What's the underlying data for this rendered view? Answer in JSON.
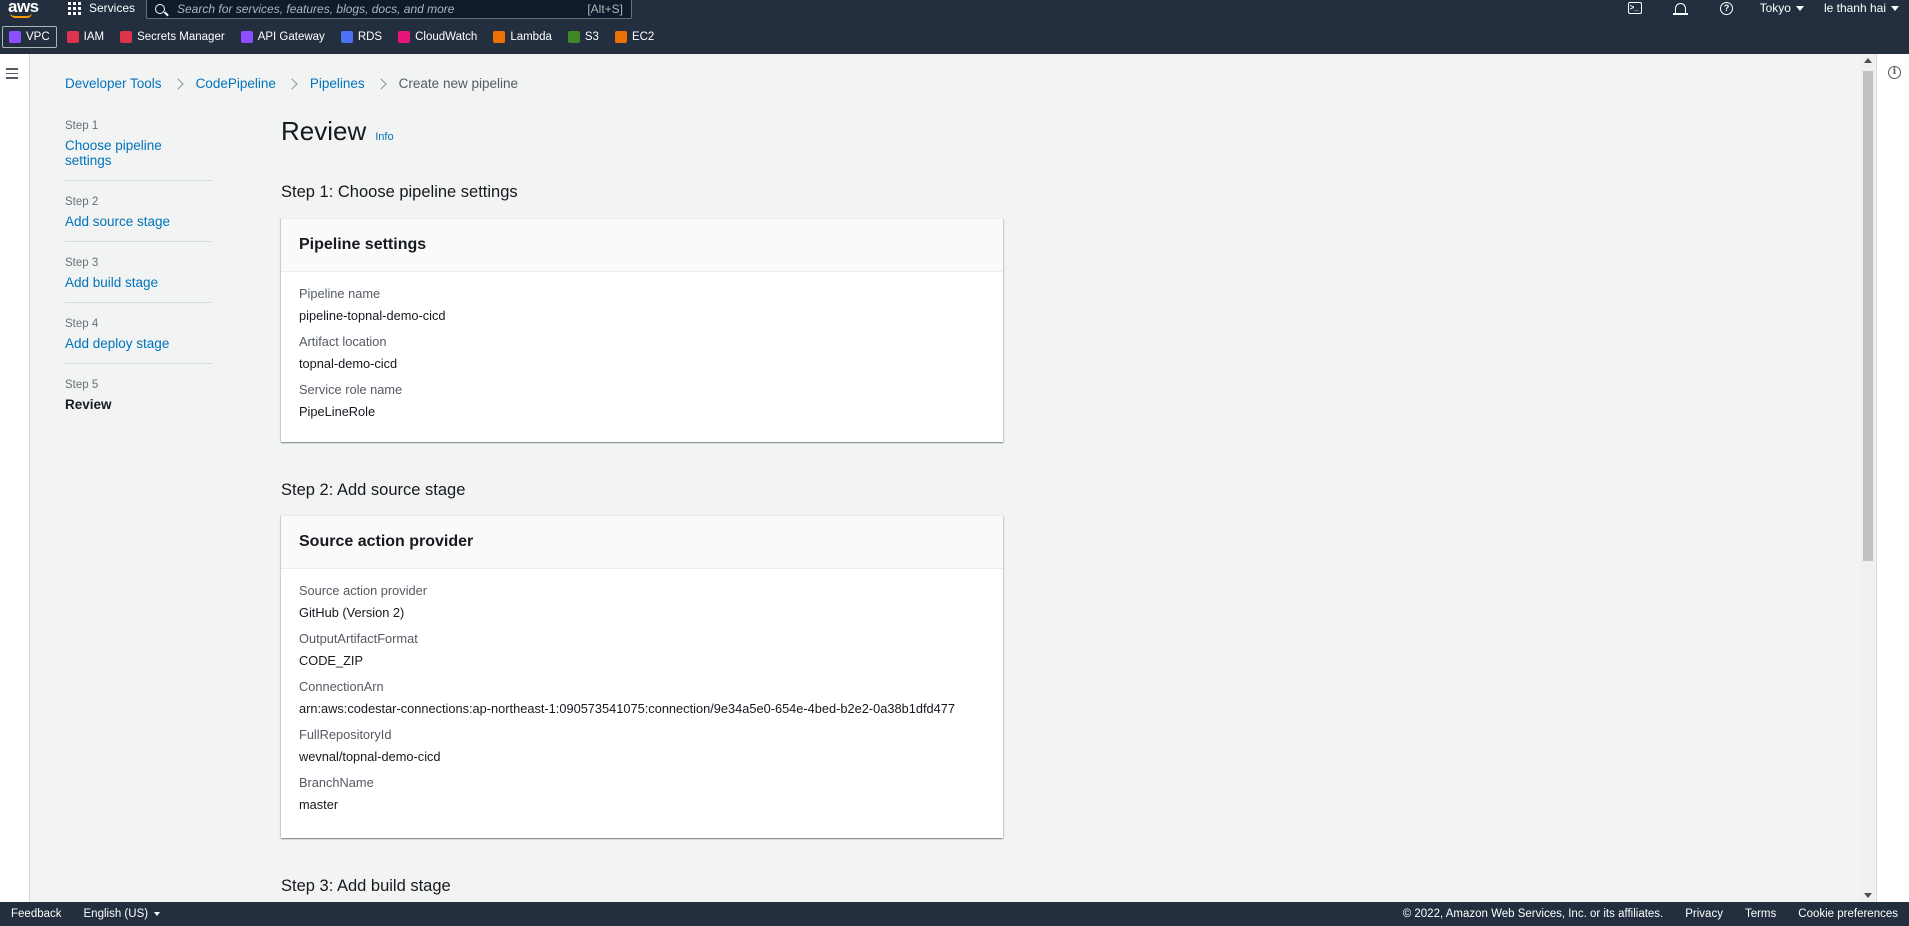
{
  "topnav": {
    "logo": "aws",
    "services_label": "Services",
    "search_placeholder": "Search for services, features, blogs, docs, and more",
    "search_shortcut": "[Alt+S]",
    "region": "Tokyo",
    "user": "le thanh hai"
  },
  "favorites": [
    {
      "label": "VPC",
      "icon": "vpc-icon",
      "color": "#8c4fff"
    },
    {
      "label": "IAM",
      "icon": "iam-icon",
      "color": "#dd344c"
    },
    {
      "label": "Secrets Manager",
      "icon": "secrets-manager-icon",
      "color": "#dd344c"
    },
    {
      "label": "API Gateway",
      "icon": "api-gateway-icon",
      "color": "#8c4fff"
    },
    {
      "label": "RDS",
      "icon": "rds-icon",
      "color": "#4d72f3"
    },
    {
      "label": "CloudWatch",
      "icon": "cloudwatch-icon",
      "color": "#e7157b"
    },
    {
      "label": "Lambda",
      "icon": "lambda-icon",
      "color": "#ed7100"
    },
    {
      "label": "S3",
      "icon": "s3-icon",
      "color": "#3f8624"
    },
    {
      "label": "EC2",
      "icon": "ec2-icon",
      "color": "#ed7100"
    }
  ],
  "breadcrumb": {
    "items": [
      "Developer Tools",
      "CodePipeline",
      "Pipelines"
    ],
    "current": "Create new pipeline"
  },
  "wizard": {
    "steps": [
      {
        "num": "Step 1",
        "label": "Choose pipeline settings"
      },
      {
        "num": "Step 2",
        "label": "Add source stage"
      },
      {
        "num": "Step 3",
        "label": "Add build stage"
      },
      {
        "num": "Step 4",
        "label": "Add deploy stage"
      },
      {
        "num": "Step 5",
        "label": "Review"
      }
    ]
  },
  "page": {
    "title": "Review",
    "info": "Info"
  },
  "sections": {
    "step1": {
      "heading": "Step 1: Choose pipeline settings",
      "card_title": "Pipeline settings",
      "fields": [
        {
          "key": "Pipeline name",
          "value": "pipeline-topnal-demo-cicd"
        },
        {
          "key": "Artifact location",
          "value": "topnal-demo-cicd"
        },
        {
          "key": "Service role name",
          "value": "PipeLineRole"
        }
      ]
    },
    "step2": {
      "heading": "Step 2: Add source stage",
      "card_title": "Source action provider",
      "fields": [
        {
          "key": "Source action provider",
          "value": "GitHub (Version 2)"
        },
        {
          "key": "OutputArtifactFormat",
          "value": "CODE_ZIP"
        },
        {
          "key": "ConnectionArn",
          "value": "arn:aws:codestar-connections:ap-northeast-1:090573541075:connection/9e34a5e0-654e-4bed-b2e2-0a38b1dfd477"
        },
        {
          "key": "FullRepositoryId",
          "value": "wevnal/topnal-demo-cicd"
        },
        {
          "key": "BranchName",
          "value": "master"
        }
      ]
    },
    "step3": {
      "heading": "Step 3: Add build stage"
    }
  },
  "footer": {
    "feedback": "Feedback",
    "language": "English (US)",
    "copyright": "© 2022, Amazon Web Services, Inc. or its affiliates.",
    "privacy": "Privacy",
    "terms": "Terms",
    "cookies": "Cookie preferences"
  }
}
